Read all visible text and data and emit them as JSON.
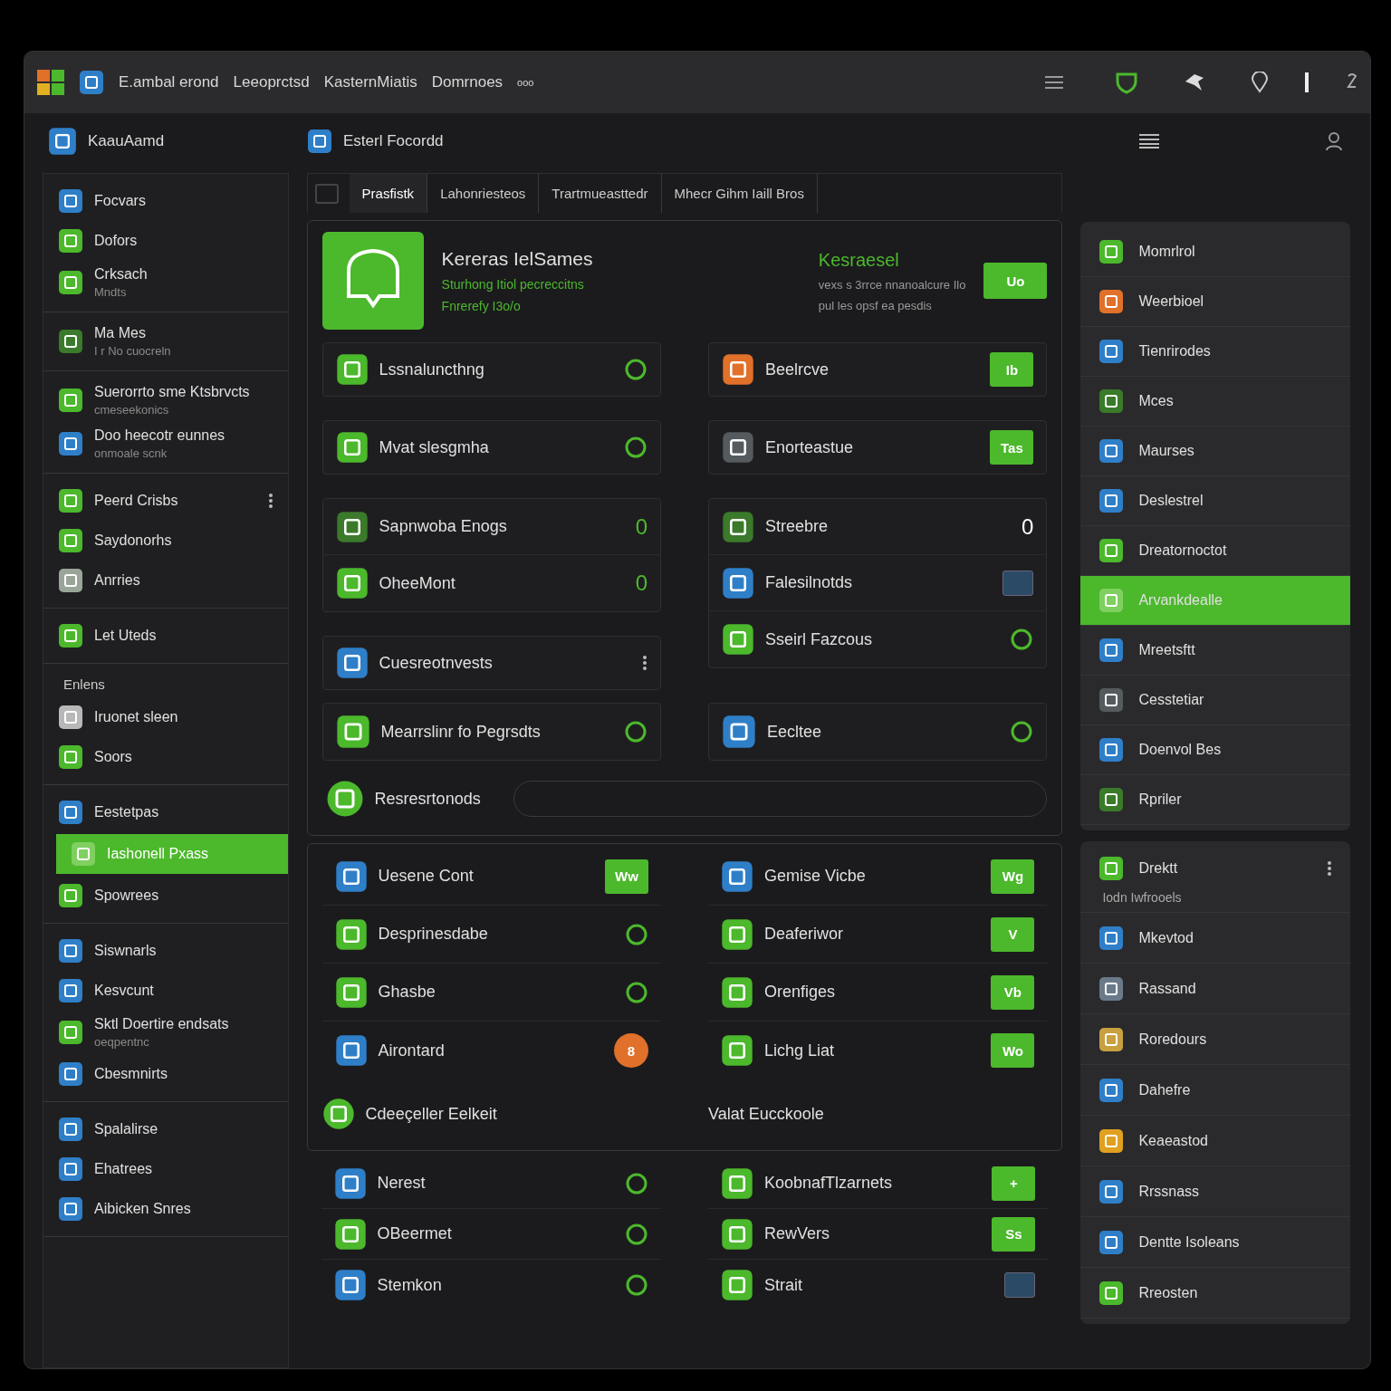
{
  "titlebar": {
    "menus": [
      "E.ambal erond",
      "Leeoprctsd",
      "KasternMiatis",
      "Domrnoes",
      "ooo"
    ]
  },
  "toolbar": {
    "workspace": "KaauAamd",
    "document": "Esterl Focordd"
  },
  "sidebar": {
    "groups": [
      {
        "items": [
          {
            "kind": "item",
            "label": "Focvars",
            "color": "#2f7fc8",
            "selected": false
          },
          {
            "kind": "item",
            "label": "Dofors",
            "color": "#4cb82c",
            "selected": false
          },
          {
            "kind": "item",
            "label": "Crksach",
            "sub": "Mndts",
            "color": "#4cb82c",
            "selected": false
          }
        ]
      },
      {
        "items": [
          {
            "kind": "item",
            "label": "Ma Mes",
            "sub": "I r No cuocreln",
            "color": "#3a7a2a",
            "selected": false
          }
        ]
      },
      {
        "items": [
          {
            "kind": "item",
            "label": "Suerorrto sme Ktsbrvcts",
            "sub": "cmeseekonics",
            "color": "#4cb82c",
            "selected": false
          },
          {
            "kind": "item",
            "label": "Doo heecotr eunnes",
            "sub": "onmoale scnk",
            "color": "#2f7fc8",
            "selected": false
          }
        ]
      },
      {
        "items": [
          {
            "kind": "item",
            "label": "Peerd Crisbs",
            "color": "#4cb82c",
            "more": true,
            "selected": false
          },
          {
            "kind": "item",
            "label": "Saydonorhs",
            "color": "#4cb82c",
            "selected": false
          },
          {
            "kind": "item",
            "label": "Anrries",
            "color": "#9aa59a",
            "selected": false
          }
        ]
      },
      {
        "items": [
          {
            "kind": "item",
            "label": "Let Uteds",
            "color": "#4cb82c",
            "selected": false
          }
        ]
      },
      {
        "items": [
          {
            "kind": "header",
            "label": "Enlens",
            "selected": false
          },
          {
            "kind": "item",
            "label": "Iruonet sleen",
            "color": "#b8b8b8",
            "selected": false
          },
          {
            "kind": "item",
            "label": "Soors",
            "color": "#4cb82c",
            "selected": false
          }
        ]
      },
      {
        "items": [
          {
            "kind": "item",
            "label": "Eestetpas",
            "color": "#2f7fc8",
            "selected": false
          },
          {
            "kind": "item",
            "label": "Iashonell Pxass",
            "color": "#7fd060",
            "selected": true
          },
          {
            "kind": "item",
            "label": "Spowrees",
            "color": "#4cb82c",
            "selected": false
          }
        ]
      },
      {
        "items": [
          {
            "kind": "item",
            "label": "Siswnarls",
            "color": "#2f7fc8",
            "selected": false
          },
          {
            "kind": "item",
            "label": "Kesvcunt",
            "color": "#2f7fc8",
            "selected": false
          },
          {
            "kind": "item",
            "label": "Sktl Doertire endsats",
            "sub": "oeqpentnc",
            "color": "#4cb82c",
            "selected": false
          },
          {
            "kind": "item",
            "label": "Cbesmnirts",
            "color": "#2f7fc8",
            "selected": false
          }
        ]
      },
      {
        "items": [
          {
            "kind": "item",
            "label": "Spalalirse",
            "color": "#2f7fc8",
            "selected": false
          },
          {
            "kind": "item",
            "label": "Ehatrees",
            "color": "#2f7fc8",
            "selected": false
          },
          {
            "kind": "item",
            "label": "Aibicken Snres",
            "color": "#2f7fc8",
            "selected": false
          }
        ]
      }
    ]
  },
  "content": {
    "select_all": {
      "checked": false
    },
    "tabs": [
      {
        "label": "Prasfistk",
        "selected": true
      },
      {
        "label": "Lahonriesteos",
        "selected": false
      },
      {
        "label": "Trartmueasttedr",
        "selected": false
      },
      {
        "label": "Mhecr Gihm Iaill Bros",
        "selected": false
      }
    ],
    "hero": {
      "title": "Kereras IelSames",
      "subtitle": [
        "Sturhong Itiol pecreccitns",
        "Fnrerefy I3o/o"
      ],
      "status_title": "Kesraesel",
      "status_text": [
        "vexs s 3rrce nnanoalcure Ilo",
        "pul les opsf ea pesdis"
      ],
      "button": "Uo"
    },
    "cards_left": [
      {
        "rows": [
          {
            "label": "Lssnaluncthng",
            "color": "#4cb82c",
            "trailing": {
              "kind": "icon"
            }
          }
        ]
      },
      {
        "rows": [
          {
            "label": "Mvat slesgmha",
            "color": "#4cb82c",
            "trailing": {
              "kind": "icon"
            }
          }
        ]
      },
      {
        "rows": [
          {
            "label": "Sapnwoba Enogs",
            "color": "#3a7a2a",
            "trailing": {
              "kind": "count",
              "text": "0",
              "highlight": true
            }
          },
          {
            "label": "OheeMont",
            "color": "#4cb82c",
            "trailing": {
              "kind": "count",
              "text": "0",
              "highlight": true
            }
          }
        ]
      },
      {
        "rows": [
          {
            "label": "Cuesreotnvests",
            "color": "#2f7fc8",
            "trailing": {
              "kind": "dots"
            }
          }
        ]
      }
    ],
    "cards_right": [
      {
        "rows": [
          {
            "label": "Beelrcve",
            "color": "#e0702a",
            "trailing": {
              "kind": "badge",
              "text": "Ib",
              "color": "#4cb82c"
            }
          }
        ]
      },
      {
        "rows": [
          {
            "label": "Enorteastue",
            "color": "#555a5e",
            "trailing": {
              "kind": "badge",
              "text": "Tas",
              "color": "#4cb82c"
            }
          }
        ]
      },
      {
        "rows": [
          {
            "label": "Streebre",
            "color": "#3a7a2a",
            "trailing": {
              "kind": "count",
              "text": "0",
              "highlight": false
            }
          },
          {
            "label": "Falesilnotds",
            "color": "#2f7fc8",
            "trailing": {
              "kind": "mini"
            }
          },
          {
            "label": "Sseirl Fazcous",
            "color": "#4cb82c",
            "trailing": {
              "kind": "icon"
            }
          }
        ]
      }
    ],
    "links": [
      {
        "label": "Mearrslinr fo Pegrsdts",
        "color": "#4cb82c"
      },
      {
        "label": "Eecltee",
        "color": "#2f7fc8"
      }
    ],
    "search": {
      "label": "Resresrtonods"
    },
    "apps_left": [
      {
        "label": "Uesene Cont",
        "color": "#2f7fc8",
        "trailing": {
          "kind": "badge",
          "text": "Ww",
          "color": "#4cb82c"
        }
      },
      {
        "label": "Desprinesdabe",
        "color": "#4cb82c",
        "trailing": {
          "kind": "icon"
        }
      },
      {
        "label": "Ghasbe",
        "color": "#4cb82c",
        "trailing": {
          "kind": "icon"
        }
      },
      {
        "label": "Airontard",
        "color": "#2f7fc8",
        "trailing": {
          "kind": "round",
          "text": "8",
          "color": "#e0702a"
        }
      }
    ],
    "apps_right": [
      {
        "label": "Gemise Vicbe",
        "color": "#2f7fc8",
        "trailing": {
          "kind": "badge",
          "text": "Wg",
          "color": "#4cb82c"
        }
      },
      {
        "label": "Deaferiwor",
        "color": "#4cb82c",
        "trailing": {
          "kind": "badge",
          "text": "V",
          "color": "#4cb82c"
        }
      },
      {
        "label": "Orenfiges",
        "color": "#4cb82c",
        "trailing": {
          "kind": "badge",
          "text": "Vb",
          "color": "#4cb82c"
        }
      },
      {
        "label": "Lichg Liat",
        "color": "#4cb82c",
        "trailing": {
          "kind": "badge",
          "text": "Wo",
          "color": "#4cb82c"
        }
      }
    ],
    "footer": {
      "left": "Cdeeçeller Eelkeit",
      "right": "Valat Eucckoole"
    },
    "more_left": [
      {
        "label": "Nerest",
        "color": "#2f7fc8",
        "trailing": {
          "kind": "icon"
        }
      },
      {
        "label": "OBeermet",
        "color": "#4cb82c",
        "trailing": {
          "kind": "icon"
        }
      },
      {
        "label": "Stemkon",
        "color": "#2f7fc8",
        "trailing": {
          "kind": "icon"
        }
      }
    ],
    "more_right": [
      {
        "label": "KoobnafTlzarnets",
        "color": "#4cb82c",
        "trailing": {
          "kind": "badge",
          "text": "+",
          "color": "#4cb82c"
        }
      },
      {
        "label": "RewVers",
        "color": "#4cb82c",
        "trailing": {
          "kind": "badge",
          "text": "Ss",
          "color": "#4cb82c"
        }
      },
      {
        "label": "Strait",
        "color": "#4cb82c",
        "trailing": {
          "kind": "mini"
        }
      }
    ]
  },
  "rail": {
    "items": [
      {
        "label": "Momrlrol",
        "color": "#4cb82c",
        "selected": false
      },
      {
        "label": "Weerbioel",
        "color": "#e0702a",
        "selected": false
      },
      {
        "label": "Tienrirodes",
        "color": "#2f7fc8",
        "selected": false
      },
      {
        "label": "Mces",
        "color": "#3a7a2a",
        "selected": false
      },
      {
        "label": "Maurses",
        "color": "#2f7fc8",
        "selected": false
      },
      {
        "label": "Deslestrel",
        "color": "#2f7fc8",
        "selected": false
      },
      {
        "label": "Dreatornoctot",
        "color": "#4cb82c",
        "selected": false
      },
      {
        "label": "Arvankdealle",
        "color": "#7fd060",
        "selected": true
      },
      {
        "label": "Mreetsftt",
        "color": "#2f7fc8",
        "selected": false
      },
      {
        "label": "Cesstetiar",
        "color": "#555a5e",
        "selected": false
      },
      {
        "label": "Doenvol Bes",
        "color": "#2f7fc8",
        "selected": false
      },
      {
        "label": "Rpriler",
        "color": "#3a7a2a",
        "selected": false
      }
    ],
    "section": {
      "title": "Drektt",
      "caption": "Iodn Iwfrooels",
      "items": [
        {
          "label": "Mkevtod",
          "color": "#2f7fc8",
          "selected": false
        },
        {
          "label": "Rassand",
          "color": "#6a7a8a",
          "selected": false
        },
        {
          "label": "Roredours",
          "color": "#c8a040",
          "selected": false
        },
        {
          "label": "Dahefre",
          "color": "#2f7fc8",
          "selected": false
        },
        {
          "label": "Keaeastod",
          "color": "#e0a020",
          "selected": false
        },
        {
          "label": "Rrssnass",
          "color": "#2f7fc8",
          "selected": false
        },
        {
          "label": "Dentte Isoleans",
          "color": "#2f7fc8",
          "selected": false
        },
        {
          "label": "Rreosten",
          "color": "#4cb82c",
          "selected": false
        }
      ]
    }
  }
}
